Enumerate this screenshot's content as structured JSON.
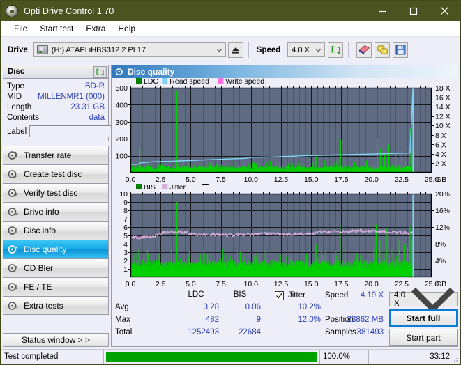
{
  "window": {
    "title": "Opti Drive Control 1.70",
    "icon": "disc-icon",
    "minimize": "minimize-icon",
    "maximize": "maximize-icon",
    "close": "close-icon"
  },
  "menu": {
    "items": [
      {
        "label": "File"
      },
      {
        "label": "Start test"
      },
      {
        "label": "Extra"
      },
      {
        "label": "Help"
      }
    ]
  },
  "toolbar": {
    "drive_label": "Drive",
    "drive_value": "(H:)  ATAPI iHBS312  2 PL17",
    "eject_icon": "eject-icon",
    "speed_label": "Speed",
    "speed_value": "4.0 X",
    "refresh_icon": "refresh-icon",
    "erase_icon": "eraser-icon",
    "discs_icon": "discs-icon",
    "save_icon": "save-icon"
  },
  "disc_panel": {
    "title": "Disc",
    "refresh_icon": "refresh-icon",
    "rows": [
      {
        "key": "Type",
        "value": "BD-R"
      },
      {
        "key": "MID",
        "value": "MILLENMR1 (000)"
      },
      {
        "key": "Length",
        "value": "23.31 GB"
      },
      {
        "key": "Contents",
        "value": "data"
      }
    ],
    "label_key": "Label",
    "label_value": "",
    "label_placeholder": "",
    "label_button_icon": "disc-yellow-icon"
  },
  "nav": {
    "items": [
      {
        "label": "Transfer rate",
        "icon": "disc-arrow-icon",
        "active": false
      },
      {
        "label": "Create test disc",
        "icon": "disc-pen-icon",
        "active": false
      },
      {
        "label": "Verify test disc",
        "icon": "disc-check-icon",
        "active": false
      },
      {
        "label": "Drive info",
        "icon": "drive-info-icon",
        "active": false
      },
      {
        "label": "Disc info",
        "icon": "disc-info-icon",
        "active": false
      },
      {
        "label": "Disc quality",
        "icon": "disc-quality-icon",
        "active": true
      },
      {
        "label": "CD Bler",
        "icon": "disc-bler-icon",
        "active": false
      },
      {
        "label": "FE / TE",
        "icon": "disc-fete-icon",
        "active": false
      },
      {
        "label": "Extra tests",
        "icon": "disc-extra-icon",
        "active": false
      }
    ],
    "status_window": "Status window > >"
  },
  "content": {
    "title": "Disc quality",
    "icon": "disc-quality-icon"
  },
  "stats": {
    "col_headers": [
      "LDC",
      "BIS"
    ],
    "row_labels": [
      "Avg",
      "Max",
      "Total"
    ],
    "ldc": {
      "avg": "3.28",
      "max": "482",
      "total": "1252493"
    },
    "bis": {
      "avg": "0.06",
      "max": "9",
      "total": "22684"
    },
    "jitter_label": "Jitter",
    "jitter_checked": true,
    "jitter_avg": "10.2%",
    "jitter_max": "12.0%",
    "speed_label": "Speed",
    "speed_value": "4.19 X",
    "position_label": "Position",
    "position_value": "23862 MB",
    "samples_label": "Samples",
    "samples_value": "381493",
    "speed_select": "4.0 X",
    "start_full": "Start full",
    "start_part": "Start part"
  },
  "statusbar": {
    "text": "Test completed",
    "progress_pct": "100.0%",
    "progress_value": 100,
    "elapsed": "33:12"
  },
  "colors": {
    "title_bar": "#4b5320",
    "plot_bg": "#5f6b82",
    "ldc_green": "#00d000",
    "read_speed": "#7fd4f4",
    "write_speed": "#ff6fe0",
    "bis_green": "#00d000",
    "jitter_pink": "#d8b0dc",
    "accent_blue": "#2a3fb8",
    "progress_green": "#00a200"
  },
  "chart_data": [
    {
      "type": "line",
      "name": "disc-quality-ldc",
      "title": "",
      "xlabel": "GB",
      "ylabel": "LDC",
      "xlim": [
        0,
        25.0
      ],
      "ylim": [
        0,
        500
      ],
      "xticks": [
        "0.0",
        "2.5",
        "5.0",
        "7.5",
        "10.0",
        "12.5",
        "15.0",
        "17.5",
        "20.0",
        "22.5",
        "25.0"
      ],
      "yticks": [
        "100",
        "200",
        "300",
        "400",
        "500"
      ],
      "y2ticks": [
        "2 X",
        "4 X",
        "6 X",
        "8 X",
        "10 X",
        "12 X",
        "14 X",
        "16 X",
        "18 X"
      ],
      "y2lim": [
        0,
        18
      ],
      "grid": true,
      "legend": [
        {
          "label": "LDC",
          "color": "#008000"
        },
        {
          "label": "Read speed",
          "color": "#7fd4f4"
        },
        {
          "label": "Write speed",
          "color": "#ff6fe0"
        }
      ],
      "series": [
        {
          "name": "LDC",
          "color": "#00d000",
          "style": "impulse",
          "x_max": 23.45,
          "baseline": 18,
          "noise": 22,
          "spikes": [
            {
              "x": 0.78,
              "y": 148
            },
            {
              "x": 3.86,
              "y": 482
            },
            {
              "x": 0.2,
              "y": 60
            },
            {
              "x": 1.5,
              "y": 45
            },
            {
              "x": 2.6,
              "y": 52
            },
            {
              "x": 4.4,
              "y": 66
            },
            {
              "x": 5.9,
              "y": 57
            },
            {
              "x": 7.2,
              "y": 50
            },
            {
              "x": 8.6,
              "y": 62
            },
            {
              "x": 10.3,
              "y": 58
            },
            {
              "x": 11.6,
              "y": 70
            },
            {
              "x": 13.1,
              "y": 55
            },
            {
              "x": 14.0,
              "y": 61
            },
            {
              "x": 15.4,
              "y": 98
            },
            {
              "x": 16.1,
              "y": 73
            },
            {
              "x": 17.45,
              "y": 195
            },
            {
              "x": 17.8,
              "y": 120
            },
            {
              "x": 18.6,
              "y": 66
            },
            {
              "x": 19.6,
              "y": 72
            },
            {
              "x": 20.5,
              "y": 198
            },
            {
              "x": 20.75,
              "y": 140
            },
            {
              "x": 21.1,
              "y": 118
            },
            {
              "x": 21.45,
              "y": 165
            },
            {
              "x": 22.0,
              "y": 112
            },
            {
              "x": 22.5,
              "y": 135
            },
            {
              "x": 22.8,
              "y": 105
            },
            {
              "x": 23.2,
              "y": 262
            },
            {
              "x": 23.35,
              "y": 150
            }
          ]
        },
        {
          "name": "Read speed",
          "color": "#7fd4f4",
          "style": "step-line",
          "points": [
            {
              "x": 0.0,
              "y": 1.75
            },
            {
              "x": 0.6,
              "y": 1.8
            },
            {
              "x": 0.9,
              "y": 2.1
            },
            {
              "x": 2.0,
              "y": 2.35
            },
            {
              "x": 3.5,
              "y": 2.45
            },
            {
              "x": 5.0,
              "y": 2.6
            },
            {
              "x": 6.5,
              "y": 2.75
            },
            {
              "x": 8.0,
              "y": 2.9
            },
            {
              "x": 9.5,
              "y": 3.05
            },
            {
              "x": 10.0,
              "y": 3.25
            },
            {
              "x": 11.5,
              "y": 3.35
            },
            {
              "x": 13.0,
              "y": 3.45
            },
            {
              "x": 14.5,
              "y": 3.6
            },
            {
              "x": 16.0,
              "y": 3.72
            },
            {
              "x": 17.5,
              "y": 3.8
            },
            {
              "x": 19.0,
              "y": 3.9
            },
            {
              "x": 20.5,
              "y": 4.0
            },
            {
              "x": 22.0,
              "y": 4.1
            },
            {
              "x": 23.2,
              "y": 4.18
            },
            {
              "x": 23.45,
              "y": 18.0
            }
          ]
        }
      ]
    },
    {
      "type": "line",
      "name": "disc-quality-bis",
      "title": "",
      "xlabel": "GB",
      "ylabel": "BIS",
      "xlim": [
        0,
        25.0
      ],
      "ylim": [
        0,
        10
      ],
      "xticks": [
        "0.0",
        "2.5",
        "5.0",
        "7.5",
        "10.0",
        "12.5",
        "15.0",
        "17.5",
        "20.0",
        "22.5",
        "25.0"
      ],
      "yticks": [
        "1",
        "2",
        "3",
        "4",
        "5",
        "6",
        "7",
        "8",
        "9",
        "10"
      ],
      "y2ticks": [
        "4%",
        "8%",
        "12%",
        "16%",
        "20%"
      ],
      "y2lim": [
        0,
        20
      ],
      "grid": true,
      "legend": [
        {
          "label": "BIS",
          "color": "#008000"
        },
        {
          "label": "Jitter",
          "color": "#d8b0dc"
        }
      ],
      "series": [
        {
          "name": "BIS",
          "color": "#00d000",
          "style": "impulse",
          "x_max": 23.45,
          "baseline": 1.0,
          "noise": 1.1,
          "spikes": [
            {
              "x": 3.86,
              "y": 9.0
            },
            {
              "x": 0.55,
              "y": 3.0
            },
            {
              "x": 1.1,
              "y": 2.6
            },
            {
              "x": 2.4,
              "y": 2.8
            },
            {
              "x": 4.9,
              "y": 3.0
            },
            {
              "x": 6.4,
              "y": 2.7
            },
            {
              "x": 8.0,
              "y": 2.9
            },
            {
              "x": 9.1,
              "y": 3.0
            },
            {
              "x": 10.4,
              "y": 2.9
            },
            {
              "x": 11.5,
              "y": 3.0
            },
            {
              "x": 13.2,
              "y": 2.6
            },
            {
              "x": 14.6,
              "y": 2.8
            },
            {
              "x": 15.4,
              "y": 4.0
            },
            {
              "x": 16.2,
              "y": 3.0
            },
            {
              "x": 17.4,
              "y": 6.2
            },
            {
              "x": 17.8,
              "y": 4.0
            },
            {
              "x": 18.8,
              "y": 2.9
            },
            {
              "x": 20.4,
              "y": 6.3
            },
            {
              "x": 20.7,
              "y": 4.4
            },
            {
              "x": 21.3,
              "y": 5.9
            },
            {
              "x": 22.3,
              "y": 4.4
            },
            {
              "x": 22.7,
              "y": 3.9
            },
            {
              "x": 23.2,
              "y": 6.1
            },
            {
              "x": 23.35,
              "y": 4.4
            }
          ]
        },
        {
          "name": "Jitter",
          "color": "#d8b0dc",
          "style": "noisy-line",
          "points": [
            {
              "x": 0.0,
              "y": 9.3
            },
            {
              "x": 0.5,
              "y": 9.5
            },
            {
              "x": 1.2,
              "y": 9.6
            },
            {
              "x": 2.0,
              "y": 9.8
            },
            {
              "x": 2.6,
              "y": 10.6
            },
            {
              "x": 3.2,
              "y": 10.9
            },
            {
              "x": 3.9,
              "y": 10.8
            },
            {
              "x": 4.6,
              "y": 10.8
            },
            {
              "x": 5.05,
              "y": 10.2
            },
            {
              "x": 6.0,
              "y": 10.2
            },
            {
              "x": 7.5,
              "y": 10.1
            },
            {
              "x": 9.0,
              "y": 10.2
            },
            {
              "x": 10.5,
              "y": 10.3
            },
            {
              "x": 11.5,
              "y": 10.4
            },
            {
              "x": 12.5,
              "y": 10.3
            },
            {
              "x": 13.5,
              "y": 10.2
            },
            {
              "x": 15.0,
              "y": 10.4
            },
            {
              "x": 16.0,
              "y": 10.9
            },
            {
              "x": 17.0,
              "y": 11.0
            },
            {
              "x": 18.0,
              "y": 10.9
            },
            {
              "x": 19.0,
              "y": 11.0
            },
            {
              "x": 20.0,
              "y": 11.0
            },
            {
              "x": 20.6,
              "y": 11.1
            },
            {
              "x": 21.5,
              "y": 10.8
            },
            {
              "x": 22.4,
              "y": 10.7
            },
            {
              "x": 23.2,
              "y": 10.5
            },
            {
              "x": 23.45,
              "y": 10.5
            }
          ]
        }
      ]
    }
  ]
}
